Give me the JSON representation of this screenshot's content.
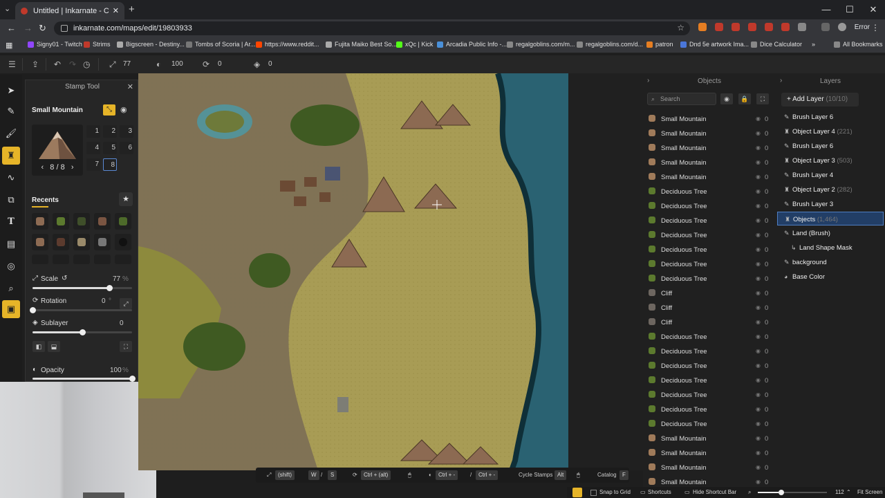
{
  "browser": {
    "tab_title": "Untitled | Inkarnate - Create Fa",
    "url": "inkarnate.com/maps/edit/19803933",
    "profile_status": "Error",
    "bookmarks": [
      "Signy01 - Twitch",
      "Strims",
      "Bigscreen - Destiny...",
      "Tombs of Scoria | Ar...",
      "https://www.reddit...",
      "Fujita Maiko Best So...",
      "xQc | Kick",
      "Arcadia Public Info -...",
      "regalgoblins.com/m...",
      "regalgoblins.com/d...",
      "patron",
      "Dnd 5e artwork Ima...",
      "Dice Calculator"
    ],
    "all_bookmarks": "All Bookmarks"
  },
  "toolbar": {
    "scale_value": "77",
    "opacity_value": "100",
    "rotation_value": "0",
    "sublayer_value": "0"
  },
  "stamp_panel": {
    "title": "Stamp Tool",
    "stamp_name": "Small Mountain",
    "variation_counter": "8 / 8",
    "variations": [
      "1",
      "2",
      "3",
      "4",
      "5",
      "6",
      "7",
      "8"
    ],
    "recents_label": "Recents",
    "scale_label": "Scale",
    "scale_value": "77",
    "scale_unit": "%",
    "scale_fraction": 0.77,
    "rotation_label": "Rotation",
    "rotation_value": "0",
    "rotation_unit": "°",
    "rotation_fraction": 0.0,
    "sublayer_label": "Sublayer",
    "sublayer_value": "0",
    "sublayer_fraction": 0.5,
    "opacity_label": "Opacity",
    "opacity_value": "100",
    "opacity_unit": "%",
    "opacity_fraction": 1.0
  },
  "objects_panel": {
    "title": "Objects",
    "search_placeholder": "Search",
    "items": [
      {
        "name": "Small Mountain",
        "count": "0",
        "icon_color": "#a07b5a"
      },
      {
        "name": "Small Mountain",
        "count": "0",
        "icon_color": "#a07b5a"
      },
      {
        "name": "Small Mountain",
        "count": "0",
        "icon_color": "#a07b5a"
      },
      {
        "name": "Small Mountain",
        "count": "0",
        "icon_color": "#a07b5a"
      },
      {
        "name": "Small Mountain",
        "count": "0",
        "icon_color": "#a07b5a"
      },
      {
        "name": "Deciduous Tree",
        "count": "0",
        "icon_color": "#5c7a2e"
      },
      {
        "name": "Deciduous Tree",
        "count": "0",
        "icon_color": "#5c7a2e"
      },
      {
        "name": "Deciduous Tree",
        "count": "0",
        "icon_color": "#5c7a2e"
      },
      {
        "name": "Deciduous Tree",
        "count": "0",
        "icon_color": "#5c7a2e"
      },
      {
        "name": "Deciduous Tree",
        "count": "0",
        "icon_color": "#5c7a2e"
      },
      {
        "name": "Deciduous Tree",
        "count": "0",
        "icon_color": "#5c7a2e"
      },
      {
        "name": "Deciduous Tree",
        "count": "0",
        "icon_color": "#5c7a2e"
      },
      {
        "name": "Cliff",
        "count": "0",
        "icon_color": "#6d6660"
      },
      {
        "name": "Cliff",
        "count": "0",
        "icon_color": "#6d6660"
      },
      {
        "name": "Cliff",
        "count": "0",
        "icon_color": "#6d6660"
      },
      {
        "name": "Deciduous Tree",
        "count": "0",
        "icon_color": "#5c7a2e"
      },
      {
        "name": "Deciduous Tree",
        "count": "0",
        "icon_color": "#5c7a2e"
      },
      {
        "name": "Deciduous Tree",
        "count": "0",
        "icon_color": "#5c7a2e"
      },
      {
        "name": "Deciduous Tree",
        "count": "0",
        "icon_color": "#5c7a2e"
      },
      {
        "name": "Deciduous Tree",
        "count": "0",
        "icon_color": "#5c7a2e"
      },
      {
        "name": "Deciduous Tree",
        "count": "0",
        "icon_color": "#5c7a2e"
      },
      {
        "name": "Deciduous Tree",
        "count": "0",
        "icon_color": "#5c7a2e"
      },
      {
        "name": "Small Mountain",
        "count": "0",
        "icon_color": "#a07b5a"
      },
      {
        "name": "Small Mountain",
        "count": "0",
        "icon_color": "#a07b5a"
      },
      {
        "name": "Small Mountain",
        "count": "0",
        "icon_color": "#a07b5a"
      },
      {
        "name": "Small Mountain",
        "count": "0",
        "icon_color": "#a07b5a"
      }
    ]
  },
  "layers_panel": {
    "title": "Layers",
    "add_layer_label": "Add Layer",
    "add_layer_count": "(10/10)",
    "layers": [
      {
        "name": "Brush Layer 6",
        "count": "",
        "icon": "brush",
        "selected": false
      },
      {
        "name": "Object Layer 4",
        "count": "(221)",
        "icon": "stamp",
        "selected": false
      },
      {
        "name": "Brush Layer 6",
        "count": "",
        "icon": "brush",
        "selected": false
      },
      {
        "name": "Object Layer 3",
        "count": "(503)",
        "icon": "stamp",
        "selected": false
      },
      {
        "name": "Brush Layer 4",
        "count": "",
        "icon": "brush",
        "selected": false
      },
      {
        "name": "Object Layer 2",
        "count": "(282)",
        "icon": "stamp",
        "selected": false
      },
      {
        "name": "Brush Layer 3",
        "count": "",
        "icon": "brush",
        "selected": false
      },
      {
        "name": "Objects",
        "count": "(1,464)",
        "icon": "stamp",
        "selected": true
      },
      {
        "name": "Land (Brush)",
        "count": "",
        "icon": "brush",
        "selected": false
      },
      {
        "name": "Land Shape Mask",
        "count": "",
        "icon": "mask",
        "selected": false
      },
      {
        "name": "background",
        "count": "",
        "icon": "brush",
        "selected": false
      },
      {
        "name": "Base Color",
        "count": "",
        "icon": "palette",
        "selected": false
      }
    ]
  },
  "shortcuts": {
    "shift": "(shift)",
    "w": "W",
    "s": "S",
    "ctrl_alt": "Ctrl + (alt)",
    "ctrl_minus": "Ctrl + -",
    "ctrl_plus": "Ctrl + -",
    "cycle_label": "Cycle Stamps",
    "alt": "Alt",
    "catalog_label": "Catalog",
    "f": "F"
  },
  "status": {
    "snap_label": "Snap to Grid",
    "shortcuts_label": "Shortcuts",
    "hide_label": "Hide Shortcut Bar",
    "zoom_value": "112",
    "fit_label": "Fit Screen",
    "zoom_fraction": 0.3
  },
  "colors": {
    "accent": "#e6b428",
    "selection": "#4f7ec3",
    "land": "#a69a52",
    "sea": "#1f5a68"
  }
}
